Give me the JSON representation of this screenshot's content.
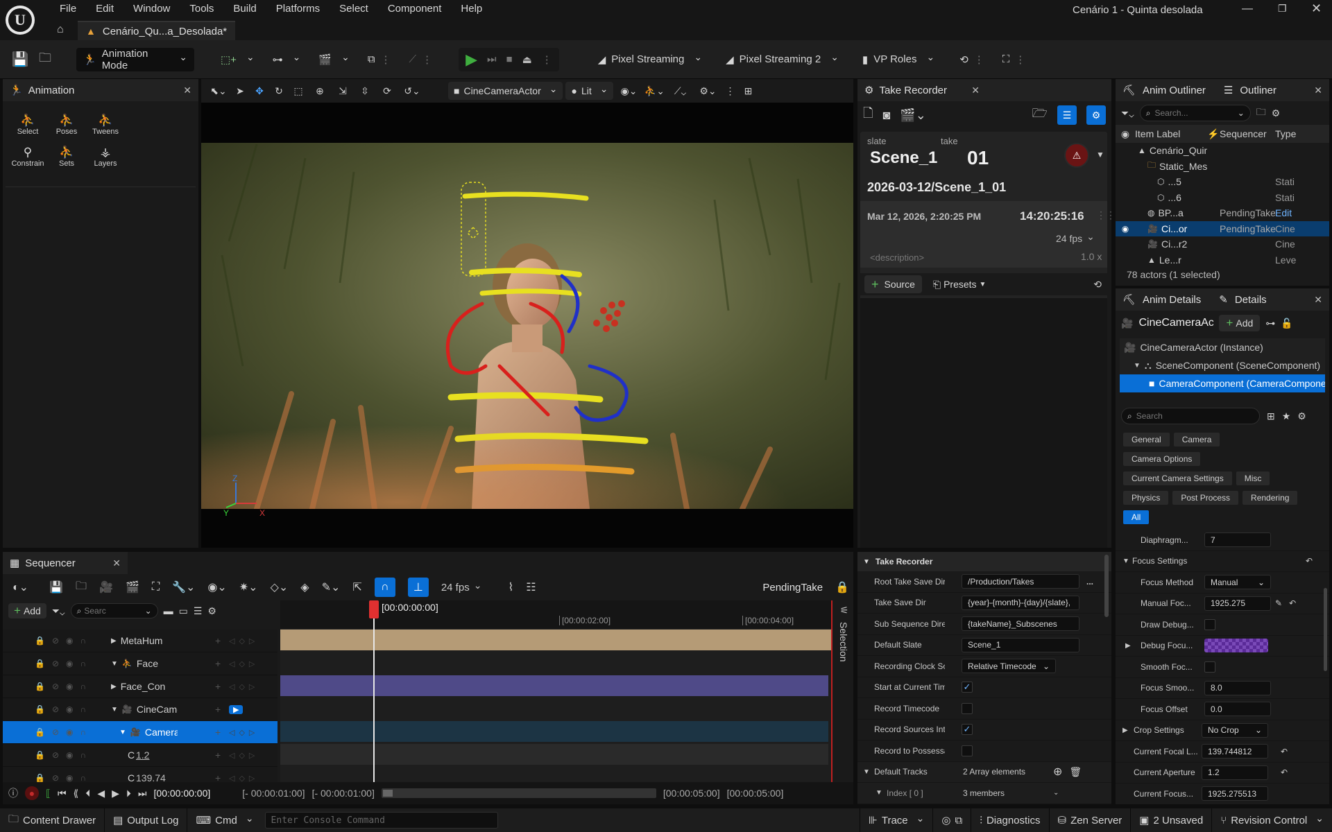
{
  "window": {
    "title": "Cenário 1 - Quinta desolada",
    "doc_tab": "Cenário_Qu...a_Desolada*"
  },
  "menu": [
    "File",
    "Edit",
    "Window",
    "Tools",
    "Build",
    "Platforms",
    "Select",
    "Component",
    "Help"
  ],
  "toolbar": {
    "mode": "Animation Mode",
    "pixel_streaming": "Pixel Streaming",
    "pixel_streaming_2": "Pixel Streaming 2",
    "vp_roles": "VP Roles"
  },
  "animation_panel": {
    "title": "Animation",
    "tools": [
      {
        "label": "Select",
        "icon": "select-icon"
      },
      {
        "label": "Poses",
        "icon": "poses-icon"
      },
      {
        "label": "Tweens",
        "icon": "tweens-icon"
      },
      {
        "label": "Constrain",
        "icon": "constrain-icon"
      },
      {
        "label": "Sets",
        "icon": "sets-icon"
      },
      {
        "label": "Layers",
        "icon": "layers-icon"
      }
    ]
  },
  "viewport": {
    "camera": "CineCameraActor",
    "view_mode": "Lit",
    "axis_z": "Z",
    "axis_y": "Y",
    "axis_x": "X"
  },
  "take_recorder": {
    "title": "Take Recorder",
    "slate_label": "slate",
    "take_label": "take",
    "slate": "Scene_1",
    "take": "01",
    "path": "2026-03-12/Scene_1_01",
    "datetime": "Mar 12, 2026, 2:20:25 PM",
    "timecode": "14:20:25:16",
    "fps": "24 fps",
    "description_placeholder": "<description>",
    "speed": "1.0 x",
    "source_button": "Source",
    "presets_button": "Presets",
    "section_title": "Take Recorder",
    "properties": [
      {
        "label": "Root Take Save Dir",
        "value": "/Production/Takes",
        "kind": "text",
        "extra": "..."
      },
      {
        "label": "Take Save Dir",
        "value": "{year}-{month}-{day}/{slate},",
        "kind": "text"
      },
      {
        "label": "Sub Sequence Direc...",
        "value": "{takeName}_Subscenes",
        "kind": "text"
      },
      {
        "label": "Default Slate",
        "value": "Scene_1",
        "kind": "text"
      },
      {
        "label": "Recording Clock So...",
        "value": "Relative Timecode",
        "kind": "combo"
      },
      {
        "label": "Start at Current Tim...",
        "value": true,
        "kind": "check"
      },
      {
        "label": "Record Timecode",
        "value": false,
        "kind": "check"
      },
      {
        "label": "Record Sources Int...",
        "value": true,
        "kind": "check"
      },
      {
        "label": "Record to Possessa...",
        "value": false,
        "kind": "check"
      }
    ],
    "default_tracks_label": "Default Tracks",
    "default_tracks_value": "2 Array elements",
    "index_label": "Index [ 0 ]",
    "index_value": "3 members"
  },
  "outliner": {
    "tab_anim": "Anim Outliner",
    "tab_outliner": "Outliner",
    "search_placeholder": "Search...",
    "columns": [
      "Item Label",
      "Sequencer",
      "Type"
    ],
    "rows": [
      {
        "label": "Cenário_Quinta_Desolada (Editor)",
        "seq": "",
        "type": "",
        "indent": 0,
        "icon": "level-icon"
      },
      {
        "label": "Static_Meshes",
        "seq": "",
        "type": "",
        "indent": 1,
        "icon": "folder-icon"
      },
      {
        "label": "...5",
        "seq": "",
        "type": "Stati",
        "indent": 2,
        "icon": "mesh-icon"
      },
      {
        "label": "...6",
        "seq": "",
        "type": "Stati",
        "indent": 2,
        "icon": "mesh-icon"
      },
      {
        "label": "BP...a",
        "seq": "PendingTake",
        "type": "Edit",
        "indent": 1,
        "icon": "blueprint-icon"
      },
      {
        "label": "Ci...or",
        "seq": "PendingTake",
        "type": "Cine",
        "indent": 1,
        "icon": "camera-icon",
        "selected": true
      },
      {
        "label": "Ci...r2",
        "seq": "",
        "type": "Cine",
        "indent": 1,
        "icon": "camera-icon"
      },
      {
        "label": "Le...r",
        "seq": "",
        "type": "Leve",
        "indent": 1,
        "icon": "level-icon"
      }
    ],
    "status": "78 actors (1 selected)"
  },
  "details": {
    "tab_anim": "Anim Details",
    "tab_details": "Details",
    "actor_name": "CineCameraActor",
    "add_button": "Add",
    "components": [
      {
        "label": "CineCameraActor (Instance)",
        "indent": 0
      },
      {
        "label": "SceneComponent (SceneComponent)",
        "indent": 1
      },
      {
        "label": "CameraComponent (CameraComponent)",
        "indent": 2,
        "selected": true
      }
    ],
    "search_placeholder": "Search",
    "categories": [
      [
        "General",
        "Camera"
      ],
      [
        "Camera Options"
      ],
      [
        "Current Camera Settings",
        "Misc"
      ],
      [
        "Physics",
        "Post Process",
        "Rendering"
      ],
      [
        "All"
      ]
    ],
    "props": [
      {
        "label": "Diaphragm...",
        "value": "7",
        "kind": "num",
        "indent": 1
      },
      {
        "label": "Focus Settings",
        "kind": "section",
        "indent": 0
      },
      {
        "label": "Focus Method",
        "value": "Manual",
        "kind": "combo",
        "indent": 1
      },
      {
        "label": "Manual Foc...",
        "value": "1925.275",
        "kind": "num",
        "indent": 1
      },
      {
        "label": "Draw Debug...",
        "value": false,
        "kind": "check",
        "indent": 1
      },
      {
        "label": "Debug Focu...",
        "value": "",
        "kind": "color",
        "indent": 1
      },
      {
        "label": "Smooth Foc...",
        "value": false,
        "kind": "check",
        "indent": 1
      },
      {
        "label": "Focus Smoo...",
        "value": "8.0",
        "kind": "num",
        "indent": 1
      },
      {
        "label": "Focus Offset",
        "value": "0.0",
        "kind": "num",
        "indent": 1
      },
      {
        "label": "Crop Settings",
        "value": "No Crop",
        "kind": "combo",
        "indent": 0
      },
      {
        "label": "Current Focal L...",
        "value": "139.744812",
        "kind": "num",
        "indent": 0
      },
      {
        "label": "Current Aperture",
        "value": "1.2",
        "kind": "num",
        "indent": 0
      },
      {
        "label": "Current Focus...",
        "value": "1925.275513",
        "kind": "num",
        "indent": 0
      }
    ]
  },
  "sequencer": {
    "title": "Sequencer",
    "add_button": "Add",
    "search_placeholder": "Searc",
    "fps": "24 fps",
    "sequence_name": "PendingTake",
    "playhead": "[00:00:00:00]",
    "ruler": [
      "[00:00:02:00]",
      "[00:00:04:00]"
    ],
    "selection_label": "Selection",
    "tracks": [
      {
        "label": "MetaHum",
        "indent": 1
      },
      {
        "label": "Face",
        "indent": 1
      },
      {
        "label": "Face_Con",
        "indent": 1
      },
      {
        "label": "CineCamer",
        "indent": 1
      },
      {
        "label": "CameraC",
        "indent": 2,
        "selected": true
      },
      {
        "label": "C",
        "value": "1.2",
        "indent": 3
      },
      {
        "label": "C",
        "value": "139.74",
        "indent": 3
      }
    ],
    "current_time": "[00:00:00:00]",
    "range_start": "[- 00:00:01:00]",
    "range_start2": "[- 00:00:01:00]",
    "range_end": "[00:00:05:00]",
    "range_end2": "[00:00:05:00]"
  },
  "statusbar": {
    "content_drawer": "Content Drawer",
    "output_log": "Output Log",
    "cmd": "Cmd",
    "console_placeholder": "Enter Console Command",
    "trace": "Trace",
    "diagnostics": "Diagnostics",
    "zen_server": "Zen Server",
    "unsaved": "2 Unsaved",
    "revision_control": "Revision Control"
  },
  "colors": {
    "accent": "#0a6fd6",
    "play": "#3fae3f",
    "record": "#c32b2b",
    "playhead": "#e03030"
  }
}
